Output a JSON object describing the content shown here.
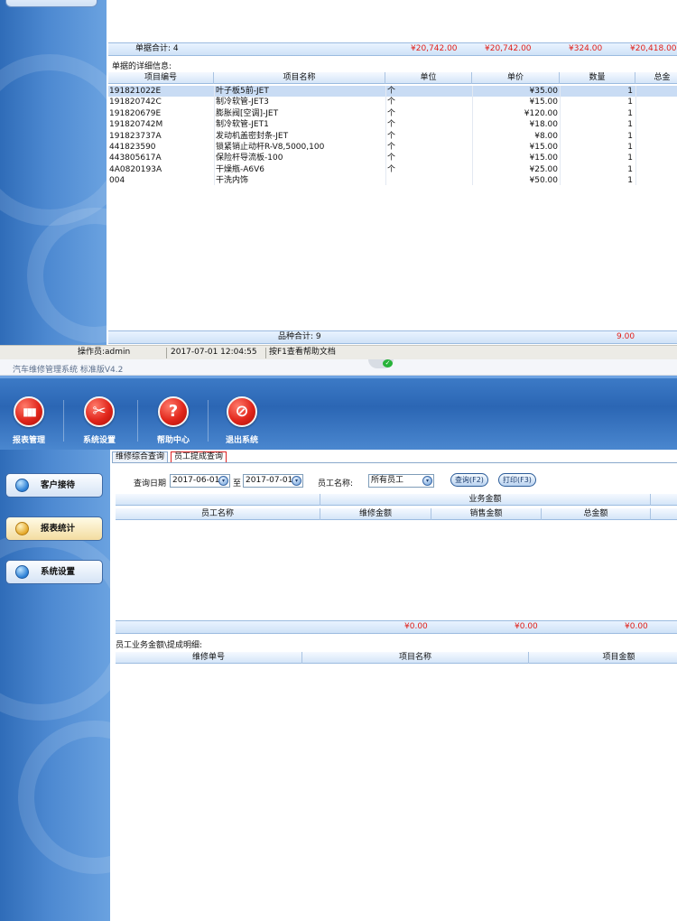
{
  "top_window": {
    "bill_total_label": "单据合计: 4",
    "bill_totals": [
      "¥20,742.00",
      "¥20,742.00",
      "¥324.00",
      "¥20,418.00"
    ],
    "detail_caption": "单据的详细信息:",
    "columns": [
      "项目编号",
      "项目名称",
      "单位",
      "单价",
      "数量",
      "总金"
    ],
    "rows": [
      {
        "code": "191821022E",
        "name": "叶子板5前-JET",
        "unit": "个",
        "price": "¥35.00",
        "qty": "1"
      },
      {
        "code": "191820742C",
        "name": "制冷软管-JET3",
        "unit": "个",
        "price": "¥15.00",
        "qty": "1"
      },
      {
        "code": "191820679E",
        "name": "膨胀阀[空调]-JET",
        "unit": "个",
        "price": "¥120.00",
        "qty": "1"
      },
      {
        "code": "191820742M",
        "name": "制冷软管-JET1",
        "unit": "个",
        "price": "¥18.00",
        "qty": "1"
      },
      {
        "code": "191823737A",
        "name": "发动机盖密封条-JET",
        "unit": "个",
        "price": "¥8.00",
        "qty": "1"
      },
      {
        "code": "441823590",
        "name": "锁紧销止动杆R-V8,5000,100",
        "unit": "个",
        "price": "¥15.00",
        "qty": "1"
      },
      {
        "code": "443805617A",
        "name": "保险杆导流板-100",
        "unit": "个",
        "price": "¥15.00",
        "qty": "1"
      },
      {
        "code": "4A0820193A",
        "name": "干燥瓶-A6V6",
        "unit": "个",
        "price": "¥25.00",
        "qty": "1"
      },
      {
        "code": "004",
        "name": "干洗内饰",
        "unit": "",
        "price": "¥50.00",
        "qty": "1"
      }
    ],
    "item_total_label": "品种合计: 9",
    "item_total_value": "9.00"
  },
  "status_bar": {
    "operator": "操作员:admin",
    "datetime": "2017-07-01 12:04:55",
    "hint": "按F1查看帮助文档"
  },
  "app": {
    "title": "汽车维修管理系统 标准版V4.2",
    "toolbar": [
      {
        "label": "报表管理",
        "icon": "bar-chart-icon",
        "glyph": "▮▮▮"
      },
      {
        "label": "系统设置",
        "icon": "tools-icon",
        "glyph": "✂"
      },
      {
        "label": "帮助中心",
        "icon": "help-icon",
        "glyph": "?"
      },
      {
        "label": "退出系统",
        "icon": "exit-icon",
        "glyph": "⊘"
      }
    ],
    "nav": [
      {
        "label": "客户接待"
      },
      {
        "label": "报表统计"
      },
      {
        "label": "系统设置"
      }
    ],
    "tabs": [
      "维修综合查询",
      "员工提成查询"
    ],
    "query": {
      "date_label": "查询日期",
      "date_from": "2017-06-01",
      "to_label": "至",
      "date_to": "2017-07-01",
      "employee_label": "员工名称:",
      "employee_value": "所有员工",
      "query_button": "查询(F2)",
      "print_button": "打印(F3)"
    },
    "grid1": {
      "group_header": "业务金额",
      "columns": [
        "员工名称",
        "维修金额",
        "销售金额",
        "总金额"
      ],
      "totals": [
        "¥0.00",
        "¥0.00",
        "¥0.00"
      ]
    },
    "detail_caption": "员工业务金额\\提成明细:",
    "grid2": {
      "columns": [
        "维修单号",
        "项目名称",
        "项目金额"
      ]
    }
  }
}
